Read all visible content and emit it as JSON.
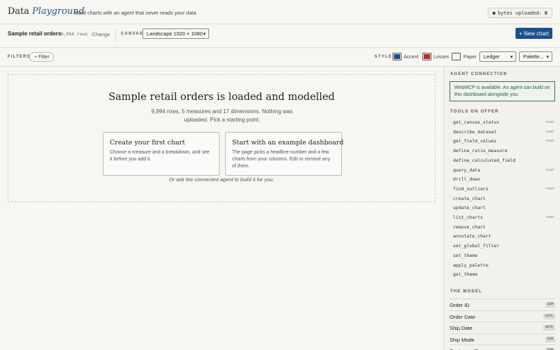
{
  "header": {
    "brand_plain": "Data",
    "brand_italic": "Playground",
    "tagline": "Build charts with an agent that never reads your data",
    "bytes_label": "bytes uploaded:",
    "bytes_value": "0"
  },
  "dataset": {
    "name": "Sample retail orders",
    "rows": "9,994 rows",
    "change_label": "Change",
    "canvas_label": "CANVAS",
    "canvas_value": "Landscape 1920 × 1080",
    "new_chart_label": "+ New chart"
  },
  "filters": {
    "label": "FILTERS",
    "add_label": "+ Filter"
  },
  "style": {
    "label": "STYLE",
    "accent_label": "Accent",
    "accent_color": "#1d4f8c",
    "losses_label": "Losses",
    "losses_color": "#b52a2a",
    "paper_label": "Paper",
    "paper_color": "#f7f6f3",
    "theme_value": "Ledger",
    "palette_value": "Palette..."
  },
  "main": {
    "title": "Sample retail orders is loaded and modelled",
    "subtitle": "9,994 rows, 5 measures and 17 dimensions. Nothing was uploaded. Pick a starting point:",
    "card1_title": "Create your first chart",
    "card1_body": "Choose a measure and a breakdown, and see it before you add it.",
    "card2_title": "Start with an example dashboard",
    "card2_body": "The page picks a headline number and a few charts from your columns. Edit or remove any of them.",
    "hint": "Or ask the connected agent to build it for you."
  },
  "panel": {
    "agent_heading": "AGENT CONNECTION",
    "agent_message": "WebMCP is available. An agent can build on this dashboard alongside you.",
    "tools_heading": "TOOLS ON OFFER",
    "read_tag": "read",
    "tools": [
      {
        "name": "get_canvas_status",
        "read": true
      },
      {
        "name": "describe_dataset",
        "read": true
      },
      {
        "name": "get_field_values",
        "read": true
      },
      {
        "name": "define_ratio_measure",
        "read": false
      },
      {
        "name": "define_calculated_field",
        "read": false
      },
      {
        "name": "query_data",
        "read": true
      },
      {
        "name": "drill_down",
        "read": false
      },
      {
        "name": "find_outliers",
        "read": true
      },
      {
        "name": "create_chart",
        "read": false
      },
      {
        "name": "update_chart",
        "read": false
      },
      {
        "name": "list_charts",
        "read": true
      },
      {
        "name": "remove_chart",
        "read": false
      },
      {
        "name": "annotate_chart",
        "read": false
      },
      {
        "name": "set_global_filter",
        "read": false
      },
      {
        "name": "set_theme",
        "read": false
      },
      {
        "name": "apply_palette",
        "read": false
      },
      {
        "name": "get_theme",
        "read": false
      }
    ],
    "model_heading": "THE MODEL",
    "model": [
      {
        "name": "Order ID",
        "kind": "DIM"
      },
      {
        "name": "Order Date",
        "kind": "DATE"
      },
      {
        "name": "Ship Date",
        "kind": "DATE"
      },
      {
        "name": "Ship Mode",
        "kind": "DIM"
      },
      {
        "name": "Customer ID",
        "kind": "DIM"
      }
    ]
  }
}
